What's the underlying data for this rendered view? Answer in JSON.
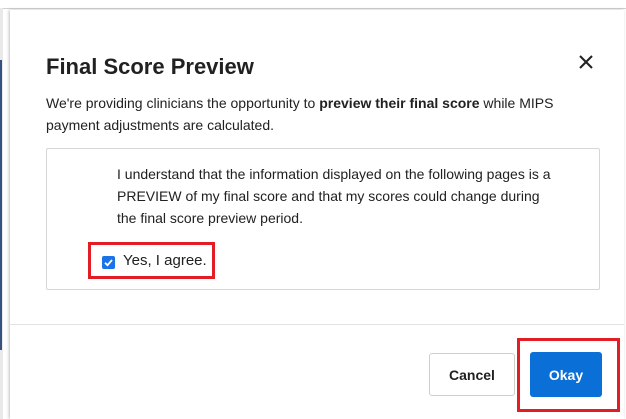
{
  "dialog": {
    "title": "Final Score Preview",
    "close_icon": "close-icon",
    "intro_before": "We're providing clinicians the opportunity to ",
    "intro_bold": "preview their final score",
    "intro_after": " while MIPS payment adjustments are calculated.",
    "consent_text": "I understand that the information displayed on the following pages is a PREVIEW of my final score and that my scores could change during the final score preview period.",
    "agree_label": "Yes, I agree.",
    "agree_checked": true,
    "cancel_label": "Cancel",
    "okay_label": "Okay"
  },
  "colors": {
    "primary": "#0a6fd6",
    "highlight": "#e21d23",
    "checkbox": "#1a73e8"
  }
}
